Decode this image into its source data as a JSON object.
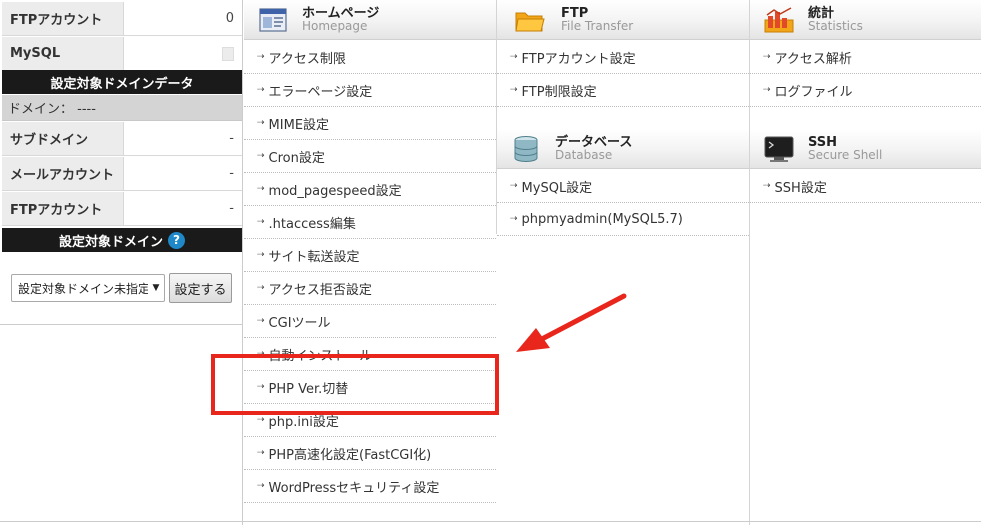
{
  "sidebar": {
    "top_rows": [
      {
        "label": "FTPアカウント",
        "value": "0"
      },
      {
        "label": "MySQL",
        "value": ""
      }
    ],
    "domain_data_header": "設定対象ドメインデータ",
    "domain_line": "ドメイン： ----",
    "domain_rows": [
      {
        "label": "サブドメイン",
        "value": "-"
      },
      {
        "label": "メールアカウント",
        "value": "-"
      },
      {
        "label": "FTPアカウント",
        "value": "-"
      }
    ],
    "domain_select_header": "設定対象ドメイン",
    "help_glyph": "?",
    "select_value": "設定対象ドメイン未指定",
    "set_button": "設定する"
  },
  "columns": {
    "homepage": {
      "title_jp": "ホームページ",
      "title_en": "Homepage",
      "icon": "homepage-icon",
      "items": [
        "アクセス制限",
        "エラーページ設定",
        "MIME設定",
        "Cron設定",
        "mod_pagespeed設定",
        ".htaccess編集",
        "サイト転送設定",
        "アクセス拒否設定",
        "CGIツール",
        "自動インストール",
        "PHP Ver.切替",
        "php.ini設定",
        "PHP高速化設定(FastCGI化)",
        "WordPressセキュリティ設定"
      ]
    },
    "ftp": {
      "title_jp": "FTP",
      "title_en": "File Transfer",
      "icon": "folder-icon",
      "items": [
        "FTPアカウント設定",
        "FTP制限設定"
      ]
    },
    "database": {
      "title_jp": "データベース",
      "title_en": "Database",
      "icon": "database-icon",
      "items": [
        "MySQL設定",
        "phpmyadmin(MySQL5.7)"
      ]
    },
    "statistics": {
      "title_jp": "統計",
      "title_en": "Statistics",
      "icon": "statistics-icon",
      "items": [
        "アクセス解析",
        "ログファイル"
      ]
    },
    "ssh": {
      "title_jp": "SSH",
      "title_en": "Secure Shell",
      "icon": "terminal-icon",
      "items": [
        "SSH設定"
      ]
    }
  },
  "bullet_glyph": "⇢",
  "colors": {
    "annotation_red": "#e8261c",
    "sidebar_header_bg": "#1a1a1a",
    "help_blue": "#1e88c8"
  }
}
